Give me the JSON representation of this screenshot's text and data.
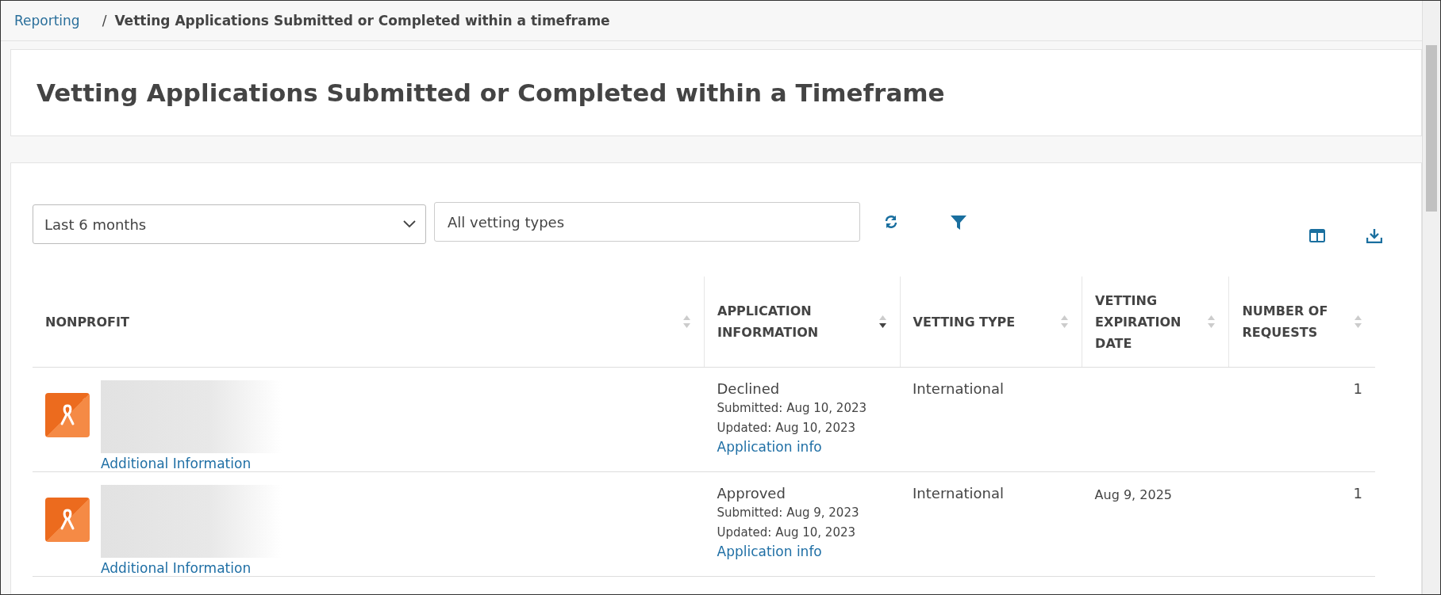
{
  "breadcrumb": {
    "link": "Reporting",
    "separator": "/",
    "current": "Vetting Applications Submitted or Completed within a timeframe"
  },
  "page_title": "Vetting Applications Submitted or Completed within a Timeframe",
  "filters": {
    "period": {
      "value": "Last 6 months"
    },
    "types": {
      "value": "All vetting types"
    }
  },
  "table": {
    "columns": [
      {
        "label": "NONPROFIT",
        "sorted_descending": false
      },
      {
        "label": "APPLICATION INFORMATION",
        "sorted_descending": true
      },
      {
        "label": "VETTING TYPE",
        "sorted_descending": false
      },
      {
        "label": "VETTING EXPIRATION DATE",
        "sorted_descending": false
      },
      {
        "label": "NUMBER OF REQUESTS",
        "sorted_descending": false
      }
    ],
    "rows": [
      {
        "link": "Additional Information",
        "status": "Declined",
        "submitted": "Submitted: Aug 10, 2023",
        "updated": "Updated: Aug 10, 2023",
        "info_link": "Application info",
        "vetting_type": "International",
        "requests": "1"
      },
      {
        "link": "Additional Information",
        "status": "Approved",
        "submitted": "Submitted: Aug 9, 2023",
        "updated": "Updated: Aug 10, 2023",
        "info_link": "Application info",
        "vetting_type": "International",
        "expiration": "Aug 9, 2025",
        "requests": "1"
      }
    ]
  }
}
